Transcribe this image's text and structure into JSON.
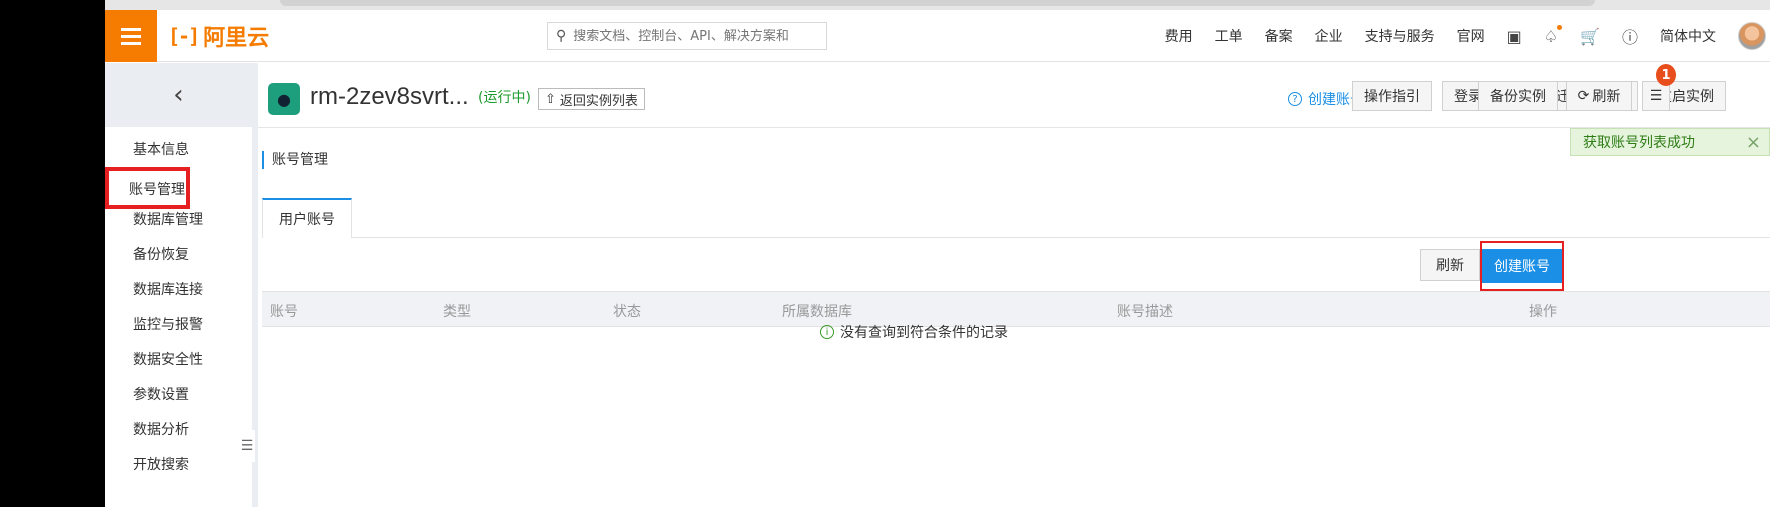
{
  "nav": {
    "logo_text": "阿里云",
    "search_placeholder": "搜索文档、控制台、API、解决方案和",
    "links": [
      "费用",
      "工单",
      "备案",
      "企业",
      "支持与服务",
      "官网"
    ],
    "language": "简体中文"
  },
  "sidebar": {
    "collapse_glyph": "‹",
    "items": [
      "基本信息",
      "账号管理",
      "数据库管理",
      "备份恢复",
      "数据库连接",
      "监控与报警",
      "数据安全性",
      "参数设置",
      "数据分析",
      "开放搜索"
    ],
    "active_index": 1,
    "toggle_glyph": "☰"
  },
  "header": {
    "instance_name": "rm-2zev8svrt...",
    "status": "(运行中)",
    "back_button": "返回实例列表",
    "create_account_link": "创建账号",
    "buttons": [
      "操作指引",
      "登录数据库",
      "迁移数据库",
      "重启实例",
      "备份实例",
      "刷新"
    ],
    "notice_count": "1"
  },
  "toast": {
    "message": "获取账号列表成功",
    "close": "×"
  },
  "section": {
    "title": "账号管理",
    "tab": "用户账号",
    "refresh_button": "刷新",
    "create_button": "创建账号"
  },
  "table": {
    "columns": [
      "账号",
      "类型",
      "状态",
      "所属数据库",
      "账号描述",
      "操作"
    ],
    "empty_message": "没有查询到符合条件的记录"
  }
}
